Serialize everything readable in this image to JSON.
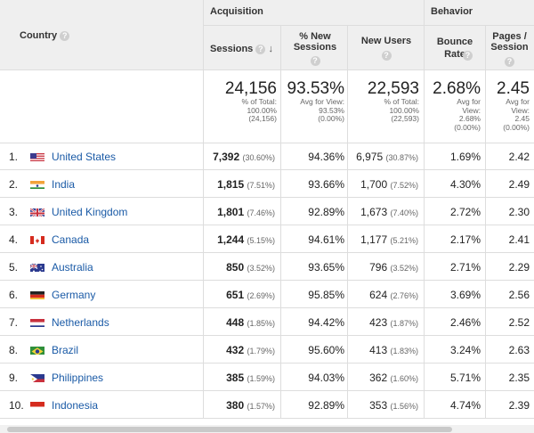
{
  "header": {
    "country_label": "Country",
    "acquisition_label": "Acquisition",
    "behavior_label": "Behavior",
    "sessions_label": "Sessions",
    "new_sessions_label": "% New Sessions",
    "new_users_label": "New Users",
    "bounce_rate_label": "Bounce Rate",
    "pages_session_label": "Pages / Session",
    "help_glyph": "?",
    "sort_glyph": "↓"
  },
  "totals": {
    "sessions": {
      "value": "24,156",
      "sub": [
        "% of Total:",
        "100.00%",
        "(24,156)"
      ]
    },
    "new_sessions": {
      "value": "93.53%",
      "sub": [
        "Avg for View:",
        "93.53%",
        "(0.00%)"
      ]
    },
    "new_users": {
      "value": "22,593",
      "sub": [
        "% of Total:",
        "100.00%",
        "(22,593)"
      ]
    },
    "bounce_rate": {
      "value": "2.68%",
      "sub": [
        "Avg for",
        "View:",
        "2.68%",
        "(0.00%)"
      ]
    },
    "pages_session": {
      "value": "2.45",
      "sub": [
        "Avg for",
        "View:",
        "2.45",
        "(0.00%)"
      ]
    }
  },
  "rows": [
    {
      "num": "1.",
      "flag": "us-flag-icon",
      "country": "United States",
      "sessions": "7,392",
      "sessions_pct": "(30.60%)",
      "new_sessions": "94.36%",
      "new_users": "6,975",
      "new_users_pct": "(30.87%)",
      "bounce": "1.69%",
      "pages": "2.42"
    },
    {
      "num": "2.",
      "flag": "in-flag-icon",
      "country": "India",
      "sessions": "1,815",
      "sessions_pct": "(7.51%)",
      "new_sessions": "93.66%",
      "new_users": "1,700",
      "new_users_pct": "(7.52%)",
      "bounce": "4.30%",
      "pages": "2.49"
    },
    {
      "num": "3.",
      "flag": "gb-flag-icon",
      "country": "United Kingdom",
      "sessions": "1,801",
      "sessions_pct": "(7.46%)",
      "new_sessions": "92.89%",
      "new_users": "1,673",
      "new_users_pct": "(7.40%)",
      "bounce": "2.72%",
      "pages": "2.30"
    },
    {
      "num": "4.",
      "flag": "ca-flag-icon",
      "country": "Canada",
      "sessions": "1,244",
      "sessions_pct": "(5.15%)",
      "new_sessions": "94.61%",
      "new_users": "1,177",
      "new_users_pct": "(5.21%)",
      "bounce": "2.17%",
      "pages": "2.41"
    },
    {
      "num": "5.",
      "flag": "au-flag-icon",
      "country": "Australia",
      "sessions": "850",
      "sessions_pct": "(3.52%)",
      "new_sessions": "93.65%",
      "new_users": "796",
      "new_users_pct": "(3.52%)",
      "bounce": "2.71%",
      "pages": "2.29"
    },
    {
      "num": "6.",
      "flag": "de-flag-icon",
      "country": "Germany",
      "sessions": "651",
      "sessions_pct": "(2.69%)",
      "new_sessions": "95.85%",
      "new_users": "624",
      "new_users_pct": "(2.76%)",
      "bounce": "3.69%",
      "pages": "2.56"
    },
    {
      "num": "7.",
      "flag": "nl-flag-icon",
      "country": "Netherlands",
      "sessions": "448",
      "sessions_pct": "(1.85%)",
      "new_sessions": "94.42%",
      "new_users": "423",
      "new_users_pct": "(1.87%)",
      "bounce": "2.46%",
      "pages": "2.52"
    },
    {
      "num": "8.",
      "flag": "br-flag-icon",
      "country": "Brazil",
      "sessions": "432",
      "sessions_pct": "(1.79%)",
      "new_sessions": "95.60%",
      "new_users": "413",
      "new_users_pct": "(1.83%)",
      "bounce": "3.24%",
      "pages": "2.63"
    },
    {
      "num": "9.",
      "flag": "ph-flag-icon",
      "country": "Philippines",
      "sessions": "385",
      "sessions_pct": "(1.59%)",
      "new_sessions": "94.03%",
      "new_users": "362",
      "new_users_pct": "(1.60%)",
      "bounce": "5.71%",
      "pages": "2.35"
    },
    {
      "num": "10.",
      "flag": "id-flag-icon",
      "country": "Indonesia",
      "sessions": "380",
      "sessions_pct": "(1.57%)",
      "new_sessions": "92.89%",
      "new_users": "353",
      "new_users_pct": "(1.56%)",
      "bounce": "4.74%",
      "pages": "2.39"
    }
  ],
  "colors": {
    "link": "#1a5aa6",
    "header_bg": "#efefef",
    "border": "#dddddd"
  }
}
